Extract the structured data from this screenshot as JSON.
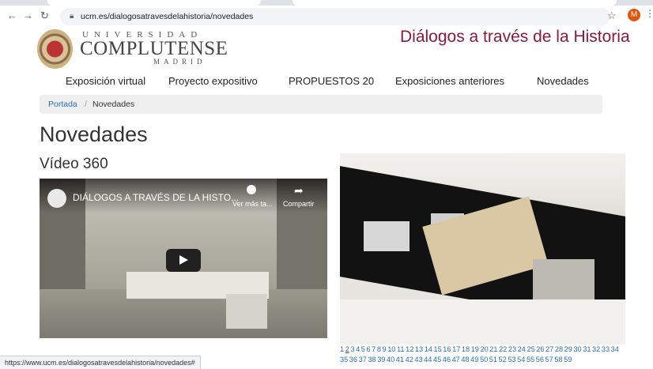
{
  "browser": {
    "url": "ucm.es/dialogosatravesdelahistoria/novedades",
    "avatar_letter": "M",
    "status_url": "https://www.ucm.es/dialogosatravesdelahistoria/novedades#"
  },
  "logo": {
    "line1": "UNIVERSIDAD",
    "line2": "COMPLUTENSE",
    "line3": "MADRID"
  },
  "site_title": "Diálogos a través de la Historia",
  "nav": {
    "items": [
      {
        "label": "Exposición virtual"
      },
      {
        "label": "Proyecto expositivo"
      },
      {
        "label": "PROPUESTOS 20"
      },
      {
        "label": "Exposiciones anteriores"
      },
      {
        "label": "Novedades"
      }
    ]
  },
  "breadcrumb": {
    "home": "Portada",
    "separator": "/",
    "current": "Novedades"
  },
  "page_title": "Novedades",
  "section_title": "Vídeo 360",
  "video": {
    "title": "DIÁLOGOS A TRAVÉS DE LA HISTO...",
    "watch_later": "Ver más ta...",
    "share": "Compartir"
  },
  "pagination": {
    "current": "2",
    "pages": [
      "1",
      "2",
      "3",
      "4",
      "5",
      "6",
      "7",
      "8",
      "9",
      "10",
      "11",
      "12",
      "13",
      "14",
      "15",
      "16",
      "17",
      "18",
      "19",
      "20",
      "21",
      "22",
      "23",
      "24",
      "25",
      "26",
      "27",
      "28",
      "29",
      "30",
      "31",
      "32",
      "33",
      "34",
      "35",
      "36",
      "37",
      "38",
      "39",
      "40",
      "41",
      "42",
      "43",
      "44",
      "45",
      "46",
      "47",
      "48",
      "49",
      "50",
      "51",
      "52",
      "53",
      "54",
      "55",
      "56",
      "57",
      "58",
      "59"
    ]
  },
  "colors": {
    "brand": "#8b1a3a",
    "link": "#2a6ebb"
  }
}
